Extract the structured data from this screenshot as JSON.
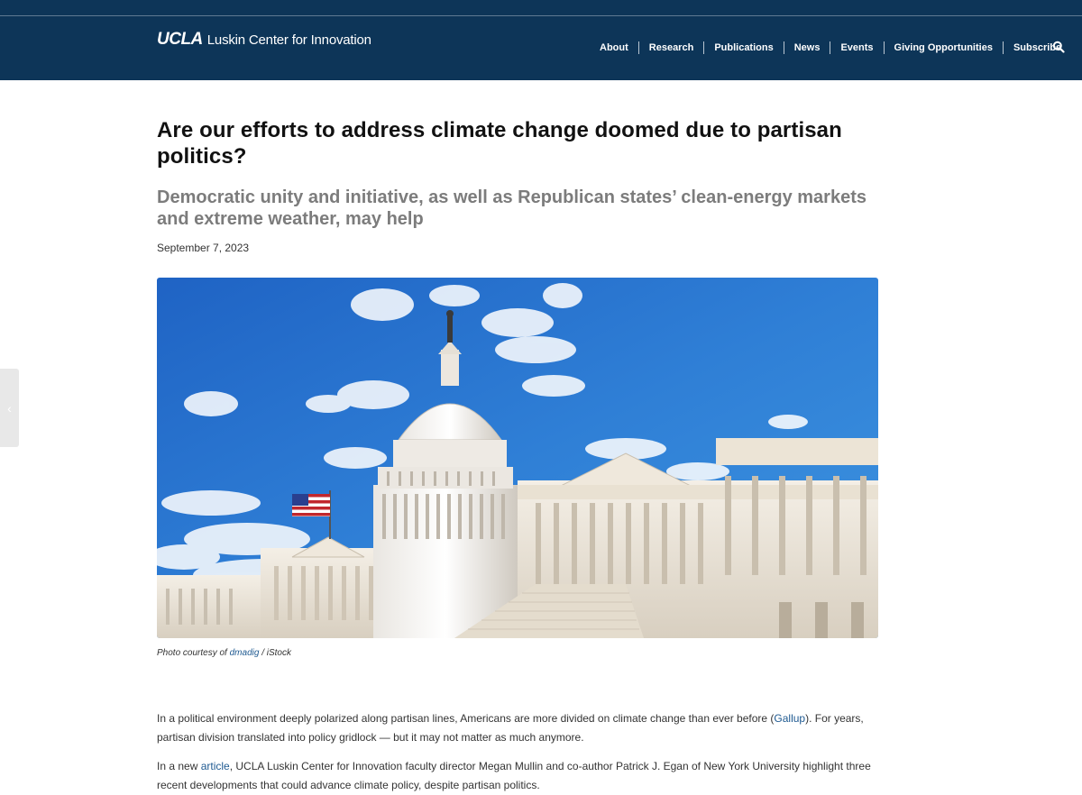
{
  "header": {
    "logo_ucla": "UCLA",
    "logo_rest": "Luskin Center for Innovation",
    "nav": [
      "About",
      "Research",
      "Publications",
      "News",
      "Events",
      "Giving Opportunities",
      "Subscribe"
    ],
    "search_icon": "search-icon"
  },
  "article": {
    "title": "Are our efforts to address climate change doomed due to partisan politics?",
    "subtitle": "Democratic unity and initiative, as well as Republican states’ clean-energy markets and extreme weather, may help",
    "date": "September 7, 2023",
    "caption": {
      "prefix": "Photo courtesy of ",
      "link": "dmadig",
      "suffix": " / iStock"
    },
    "p1": {
      "text1": "In a political environment deeply polarized along partisan lines, Americans are more divided on climate change than ever before (",
      "link": "Gallup",
      "text2": "). For years, partisan division translated into policy gridlock — but it may not matter as much anymore."
    },
    "p2": {
      "text1": "In a new ",
      "link": "article",
      "text2": ", UCLA Luskin Center for Innovation faculty director Megan Mullin and co-author Patrick J. Egan of New York University highlight three recent developments that could advance climate policy, despite partisan politics."
    }
  },
  "side_tab": {
    "icon": "chevron-left-icon",
    "glyph": "‹"
  },
  "colors": {
    "header_bg": "#0d3558",
    "link": "#1f5a91",
    "subtitle": "#7c7c7c"
  }
}
